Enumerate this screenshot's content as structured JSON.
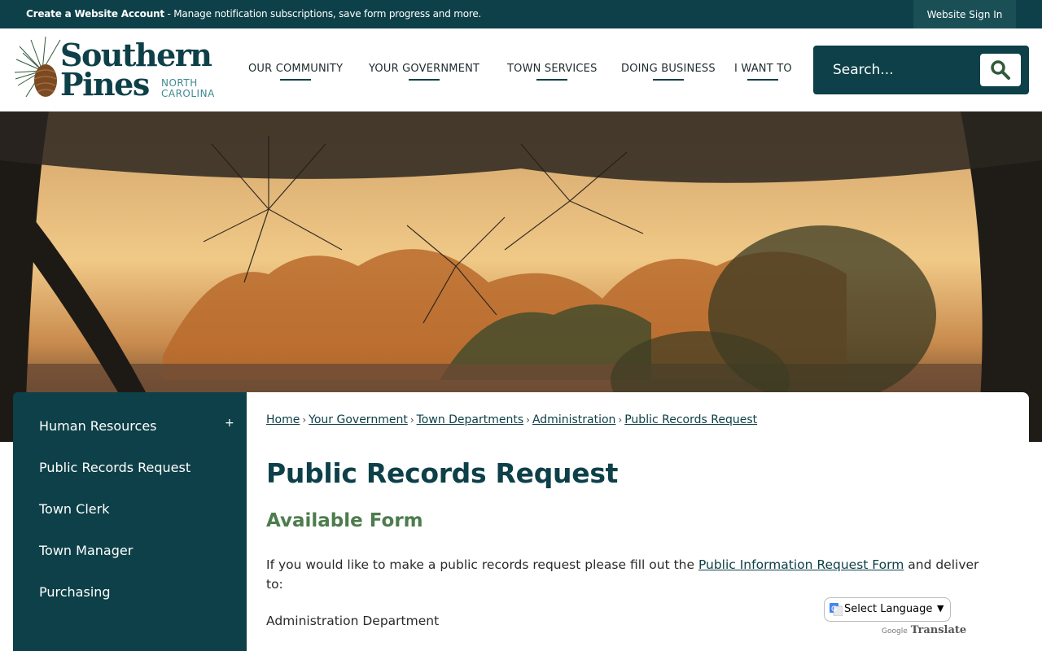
{
  "topbar": {
    "create_account": "Create a Website Account",
    "create_account_desc": " - Manage notification subscriptions, save form progress and more.",
    "sign_in": "Website Sign In"
  },
  "logo": {
    "line1": "Southern",
    "line2": "Pines",
    "state_line1": "NORTH",
    "state_line2": "CAROLINA"
  },
  "nav": {
    "items": [
      {
        "label": "OUR COMMUNITY"
      },
      {
        "label": "YOUR GOVERNMENT"
      },
      {
        "label": "TOWN SERVICES"
      },
      {
        "label": "DOING BUSINESS"
      },
      {
        "label": "I WANT TO"
      }
    ]
  },
  "search": {
    "placeholder": "Search..."
  },
  "sidebar": {
    "items": [
      {
        "label": "Human Resources",
        "expand": "+"
      },
      {
        "label": "Public Records Request"
      },
      {
        "label": "Town Clerk"
      },
      {
        "label": "Town Manager"
      },
      {
        "label": "Purchasing"
      }
    ]
  },
  "breadcrumb": {
    "items": [
      "Home",
      "Your Government",
      "Town Departments",
      "Administration",
      "Public Records Request"
    ],
    "separator": "›"
  },
  "main": {
    "title": "Public Records Request",
    "subtitle": "Available Form",
    "para_before": "If you would like to make a public records request please fill out the ",
    "para_link": "Public Information Request Form",
    "para_after": " and deliver to:",
    "department": "Administration Department"
  },
  "translate": {
    "select_label": "Select Language",
    "powered_google": "Google",
    "powered_translate": "Translate"
  },
  "colors": {
    "brand_dark_teal": "#0d4048",
    "accent_green": "#4d7c4d",
    "logo_light_teal": "#3e8a93"
  }
}
